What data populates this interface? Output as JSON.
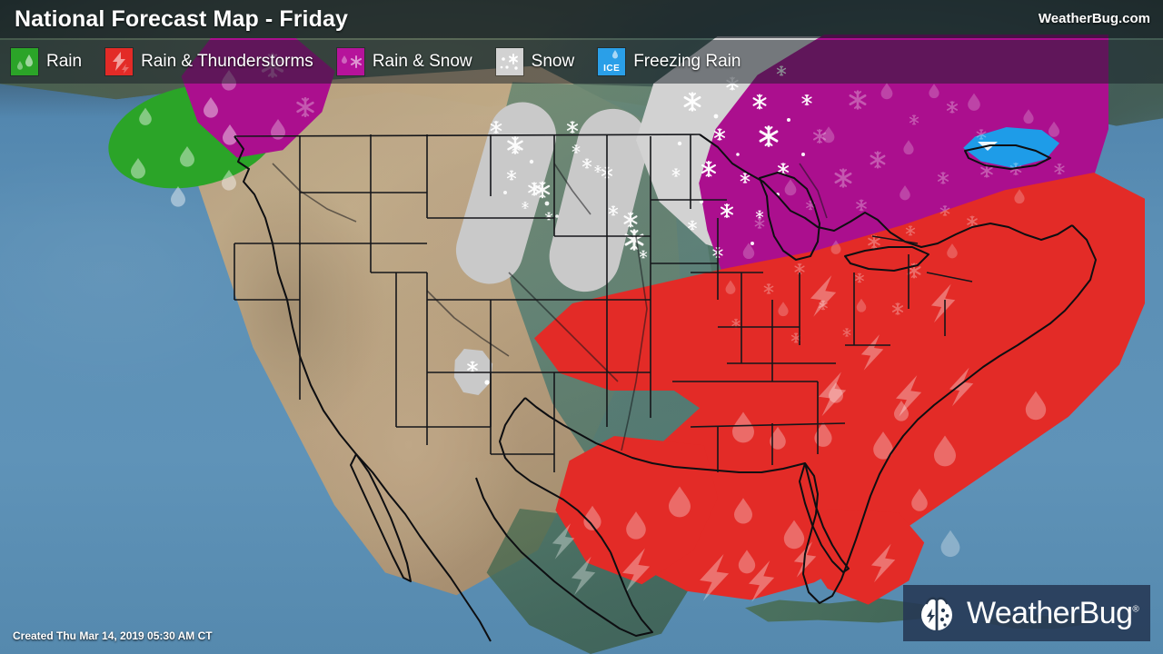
{
  "header": {
    "title": "National Forecast Map - Friday",
    "brand_url": "WeatherBug.com"
  },
  "legend": {
    "items": [
      {
        "label": "Rain",
        "icon": "raindrop-icon",
        "color": "#2ba428"
      },
      {
        "label": "Rain & Thunderstorms",
        "icon": "lightning-bolt-icon",
        "color": "#e32b27"
      },
      {
        "label": "Rain & Snow",
        "icon": "snowflake-icon",
        "color": "#b6139b"
      },
      {
        "label": "Snow",
        "icon": "snowflake-icon",
        "color": "#d2d2d2"
      },
      {
        "label": "Freezing Rain",
        "icon": "ice-icon",
        "color": "#2a9fe8",
        "badge": "ICE"
      }
    ]
  },
  "footer": {
    "created": "Created Thu Mar 14, 2019 05:30 AM CT",
    "logo_text": "WeatherBug",
    "logo_registered": "®",
    "logo_icon": "weatherbug-ladybug-icon"
  },
  "map": {
    "ocean_color": "#5b8fb5",
    "land_west_color": "#b99f7c",
    "land_plains_color": "#5e8174",
    "land_east_color": "#4d7063",
    "border_color": "#15161a",
    "regions": [
      {
        "name": "rain-pacific-northwest",
        "type": "Rain",
        "color": "#2ba428"
      },
      {
        "name": "rain-snow-british-columbia",
        "type": "Rain & Snow",
        "color": "#ab0f8e"
      },
      {
        "name": "snow-band-montana",
        "type": "Snow",
        "color": "#c9c9c9"
      },
      {
        "name": "snow-band-dakotas",
        "type": "Snow",
        "color": "#c9c9c9"
      },
      {
        "name": "snow-mass-upper-midwest",
        "type": "Snow",
        "color": "#c9c9c9"
      },
      {
        "name": "snow-patch-colorado",
        "type": "Snow",
        "color": "#c9c9c9"
      },
      {
        "name": "rain-snow-great-lakes-northeast",
        "type": "Rain & Snow",
        "color": "#ab0f8e"
      },
      {
        "name": "rain-snow-appalachians",
        "type": "Rain & Snow",
        "color": "#ab0f8e"
      },
      {
        "name": "freezing-rain-lake-ontario",
        "type": "Freezing Rain",
        "color": "#1e9ce8"
      },
      {
        "name": "thunderstorms-southeast-gulf",
        "type": "Rain & Thunderstorms",
        "color": "#e32b27"
      },
      {
        "name": "thunderstorms-texas-coast",
        "type": "Rain & Thunderstorms",
        "color": "#e32b27"
      },
      {
        "name": "thunderstorms-florida",
        "type": "Rain & Thunderstorms",
        "color": "#e32b27"
      }
    ]
  }
}
